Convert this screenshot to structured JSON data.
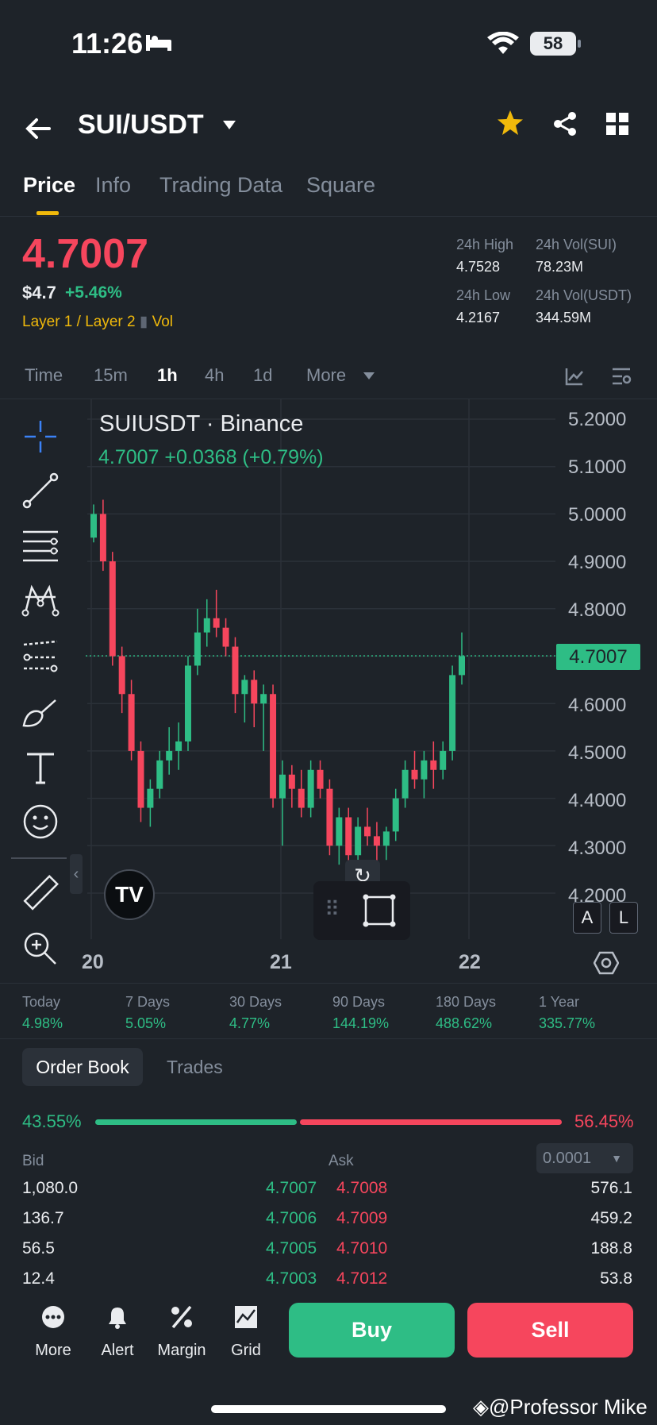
{
  "status": {
    "time": "11:26",
    "battery": "58"
  },
  "header": {
    "pair": "SUI/USDT",
    "icons": [
      "back-arrow",
      "star",
      "share",
      "grid"
    ]
  },
  "tabs": [
    "Price",
    "Info",
    "Trading Data",
    "Square"
  ],
  "price": {
    "last": "4.7007",
    "usd": "$4.7",
    "change": "+5.46%",
    "tag1": "Layer 1 / Layer 2",
    "tag2": "Vol"
  },
  "stats": {
    "high_label": "24h High",
    "high": "4.7528",
    "vol_sui_label": "24h Vol(SUI)",
    "vol_sui": "78.23M",
    "low_label": "24h Low",
    "low": "4.2167",
    "vol_usdt_label": "24h Vol(USDT)",
    "vol_usdt": "344.59M"
  },
  "timeframes": [
    "Time",
    "15m",
    "1h",
    "4h",
    "1d",
    "More"
  ],
  "chart": {
    "title": "SUIUSDT · Binance",
    "sub": "4.7007  +0.0368 (+0.79%)",
    "yticks": [
      "5.2000",
      "5.1000",
      "5.0000",
      "4.9000",
      "4.8000",
      "4.6000",
      "4.5000",
      "4.4000",
      "4.3000",
      "4.2000"
    ],
    "price_tag": "4.7007",
    "xticks": [
      "20",
      "21",
      "22"
    ],
    "scale_a": "A",
    "scale_l": "L"
  },
  "chart_data": {
    "type": "candlestick",
    "ohlc": [
      [
        4.95,
        5.02,
        4.94,
        5.0
      ],
      [
        5.0,
        5.03,
        4.88,
        4.9
      ],
      [
        4.9,
        4.92,
        4.68,
        4.7
      ],
      [
        4.7,
        4.72,
        4.58,
        4.62
      ],
      [
        4.62,
        4.65,
        4.48,
        4.5
      ],
      [
        4.5,
        4.52,
        4.35,
        4.38
      ],
      [
        4.38,
        4.44,
        4.34,
        4.42
      ],
      [
        4.42,
        4.5,
        4.4,
        4.48
      ],
      [
        4.48,
        4.55,
        4.45,
        4.5
      ],
      [
        4.5,
        4.56,
        4.46,
        4.52
      ],
      [
        4.52,
        4.7,
        4.5,
        4.68
      ],
      [
        4.68,
        4.8,
        4.66,
        4.75
      ],
      [
        4.75,
        4.82,
        4.72,
        4.78
      ],
      [
        4.78,
        4.84,
        4.74,
        4.76
      ],
      [
        4.76,
        4.78,
        4.7,
        4.72
      ],
      [
        4.72,
        4.74,
        4.58,
        4.62
      ],
      [
        4.62,
        4.66,
        4.56,
        4.65
      ],
      [
        4.65,
        4.67,
        4.55,
        4.6
      ],
      [
        4.6,
        4.64,
        4.5,
        4.62
      ],
      [
        4.62,
        4.64,
        4.38,
        4.4
      ],
      [
        4.4,
        4.48,
        4.3,
        4.45
      ],
      [
        4.45,
        4.47,
        4.38,
        4.42
      ],
      [
        4.42,
        4.46,
        4.36,
        4.38
      ],
      [
        4.38,
        4.48,
        4.36,
        4.46
      ],
      [
        4.46,
        4.48,
        4.4,
        4.42
      ],
      [
        4.42,
        4.44,
        4.28,
        4.3
      ],
      [
        4.3,
        4.38,
        4.26,
        4.36
      ],
      [
        4.36,
        4.38,
        4.24,
        4.28
      ],
      [
        4.28,
        4.36,
        4.26,
        4.34
      ],
      [
        4.34,
        4.38,
        4.3,
        4.32
      ],
      [
        4.32,
        4.35,
        4.25,
        4.3
      ],
      [
        4.3,
        4.34,
        4.27,
        4.33
      ],
      [
        4.33,
        4.42,
        4.31,
        4.4
      ],
      [
        4.4,
        4.48,
        4.38,
        4.46
      ],
      [
        4.46,
        4.5,
        4.42,
        4.44
      ],
      [
        4.44,
        4.5,
        4.4,
        4.48
      ],
      [
        4.48,
        4.52,
        4.42,
        4.46
      ],
      [
        4.46,
        4.52,
        4.44,
        4.5
      ],
      [
        4.5,
        4.68,
        4.48,
        4.66
      ],
      [
        4.66,
        4.75,
        4.64,
        4.7
      ]
    ],
    "ylim": [
      4.2,
      5.2
    ],
    "last": 4.7007
  },
  "perf": [
    {
      "l": "Today",
      "v": "4.98%"
    },
    {
      "l": "7 Days",
      "v": "5.05%"
    },
    {
      "l": "30 Days",
      "v": "4.77%"
    },
    {
      "l": "90 Days",
      "v": "144.19%"
    },
    {
      "l": "180 Days",
      "v": "488.62%"
    },
    {
      "l": "1 Year",
      "v": "335.77%"
    }
  ],
  "orderbook": {
    "tab1": "Order Book",
    "tab2": "Trades",
    "bid_pct": "43.55%",
    "ask_pct": "56.45%",
    "bid_label": "Bid",
    "ask_label": "Ask",
    "precision": "0.0001",
    "rows": [
      [
        "1,080.0",
        "4.7007",
        "4.7008",
        "576.1"
      ],
      [
        "136.7",
        "4.7006",
        "4.7009",
        "459.2"
      ],
      [
        "56.5",
        "4.7005",
        "4.7010",
        "188.8"
      ],
      [
        "12.4",
        "4.7003",
        "4.7012",
        "53.8"
      ]
    ]
  },
  "bottom": {
    "more": "More",
    "alert": "Alert",
    "margin": "Margin",
    "grid": "Grid",
    "buy": "Buy",
    "sell": "Sell"
  },
  "watermark": "@Professor Mike"
}
